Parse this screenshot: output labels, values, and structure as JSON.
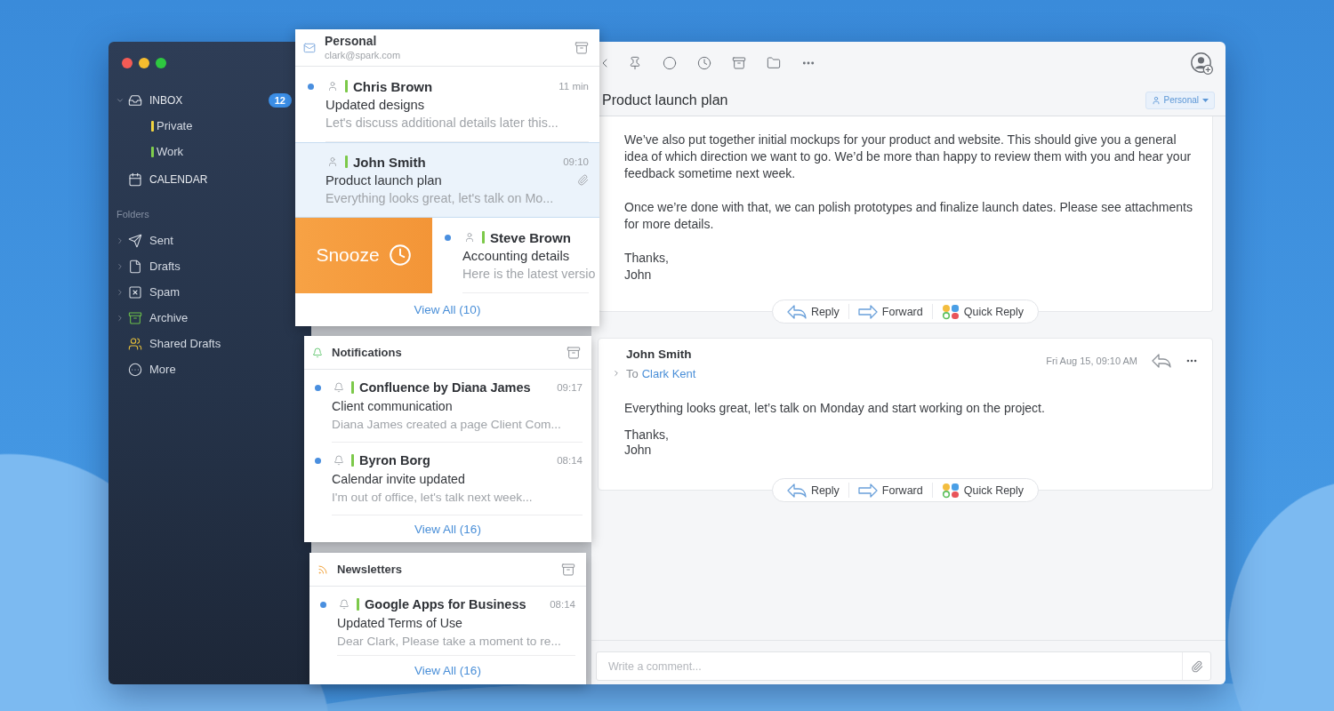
{
  "sidebar": {
    "mailboxes": [
      {
        "label": "INBOX",
        "expanded": true,
        "badge": "12",
        "children": [
          {
            "label": "Private",
            "color": "#f2d541"
          },
          {
            "label": "Work",
            "color": "#7fce4c"
          }
        ]
      },
      {
        "label": "CALENDAR"
      }
    ],
    "folders_heading": "Folders",
    "folders": [
      {
        "label": "Sent",
        "expandable": true
      },
      {
        "label": "Drafts",
        "expandable": true
      },
      {
        "label": "Spam",
        "expandable": true
      },
      {
        "label": "Archive",
        "expandable": true
      },
      {
        "label": "Shared Drafts",
        "expandable": false
      },
      {
        "label": "More",
        "expandable": false
      }
    ]
  },
  "lists": [
    {
      "kind": "account",
      "title": "Personal",
      "subtitle": "clark@spark.com",
      "messages": [
        {
          "sender": "Chris Brown",
          "time": "11 min",
          "subject": "Updated designs",
          "preview": "Let's discuss additional details later this...",
          "unread": true,
          "selected": false,
          "attachment": false
        },
        {
          "sender": "John Smith",
          "time": "09:10",
          "subject": "Product launch plan",
          "preview": "Everything looks great, let's talk on Mo...",
          "unread": false,
          "selected": true,
          "attachment": true
        },
        {
          "sender": "Steve Brown",
          "subject": "Accounting details",
          "preview": "Here is the latest versio",
          "unread": true,
          "selected": false,
          "attachment": false,
          "swipe_label": "Snooze"
        }
      ],
      "footer": "View All (10)"
    },
    {
      "kind": "notifications",
      "title": "Notifications",
      "messages": [
        {
          "sender": "Confluence by Diana James",
          "time": "09:17",
          "subject": "Client communication",
          "preview": "Diana James created a page Client Com...",
          "unread": true,
          "selected": false,
          "attachment": false
        },
        {
          "sender": "Byron Borg",
          "time": "08:14",
          "subject": "Calendar invite updated",
          "preview": "I'm out of office, let's talk next week...",
          "unread": true,
          "selected": false,
          "attachment": false
        }
      ],
      "footer": "View All (16)"
    },
    {
      "kind": "newsletters",
      "title": "Newsletters",
      "messages": [
        {
          "sender": "Google Apps for Business",
          "time": "08:14",
          "subject": "Updated Terms of Use",
          "preview": "Dear Clark, Please take a moment to re...",
          "unread": true,
          "selected": false,
          "attachment": false
        }
      ],
      "footer": "View All (16)"
    }
  ],
  "reader": {
    "subject": "Product launch plan",
    "account_tag": "Personal",
    "messages": [
      {
        "kind": "continued",
        "paragraphs": [
          "We’ve also put together initial mockups for your product and website. This should give you a general idea of which direction we want to go. We’d be more than happy to review them with you and hear your feedback sometime next week.",
          "Once we’re done with that, we can polish prototypes and finalize launch dates. Please see attachments for more details.",
          "Thanks,\nJohn"
        ],
        "actions": [
          {
            "kind": "reply",
            "label": "Reply"
          },
          {
            "kind": "forward",
            "label": "Forward"
          },
          {
            "kind": "quick",
            "label": "Quick Reply"
          }
        ]
      },
      {
        "kind": "full",
        "sender": "John Smith",
        "to_label": "To",
        "recipient": "Clark Kent",
        "date": "Fri Aug 15, 09:10 AM",
        "paragraphs": [
          "Everything looks great, let’s talk on Monday and start working on the project.",
          "Thanks,\nJohn"
        ],
        "actions": [
          {
            "kind": "reply",
            "label": "Reply"
          },
          {
            "kind": "forward",
            "label": "Forward"
          },
          {
            "kind": "quick",
            "label": "Quick Reply"
          }
        ]
      }
    ],
    "comment": {
      "placeholder": "Write a comment..."
    }
  }
}
